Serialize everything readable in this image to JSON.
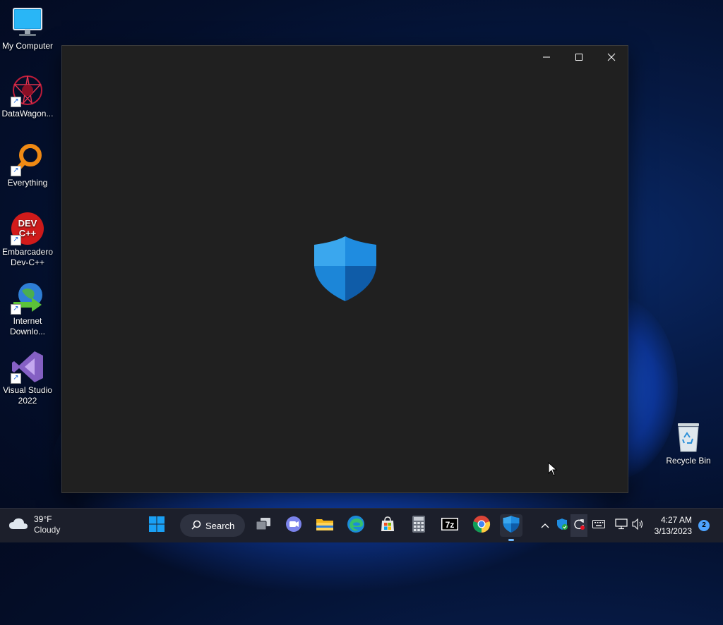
{
  "desktop": {
    "icons": [
      {
        "label": "My Computer"
      },
      {
        "label": "DataWagon..."
      },
      {
        "label": "Everything"
      },
      {
        "label": "Embarcadero Dev-C++"
      },
      {
        "label": "Internet Downlo..."
      },
      {
        "label": "Visual Studio 2022"
      },
      {
        "label": "Recycle Bin"
      }
    ]
  },
  "window": {
    "minimize_symbol": "—",
    "maximize_symbol": "☐",
    "close_symbol": "✕",
    "logo": "windows-security-shield-icon"
  },
  "taskbar": {
    "weather": {
      "temp": "39°F",
      "condition": "Cloudy"
    },
    "search_label": "Search",
    "apps": [
      "start",
      "search",
      "task-view",
      "teams-chat",
      "file-explorer",
      "edge",
      "microsoft-store",
      "calculator",
      "7zip",
      "chrome",
      "windows-security"
    ],
    "tray": [
      "show-hidden-icons",
      "defender-status",
      "sync-update",
      "keyboard",
      "network",
      "volume"
    ],
    "clock": {
      "time": "4:27 AM",
      "date": "3/13/2023"
    },
    "notifications": "2"
  },
  "colors": {
    "accent": "#0078d4",
    "window_bg": "#202020",
    "taskbar_bg": "#1c1f2b"
  }
}
